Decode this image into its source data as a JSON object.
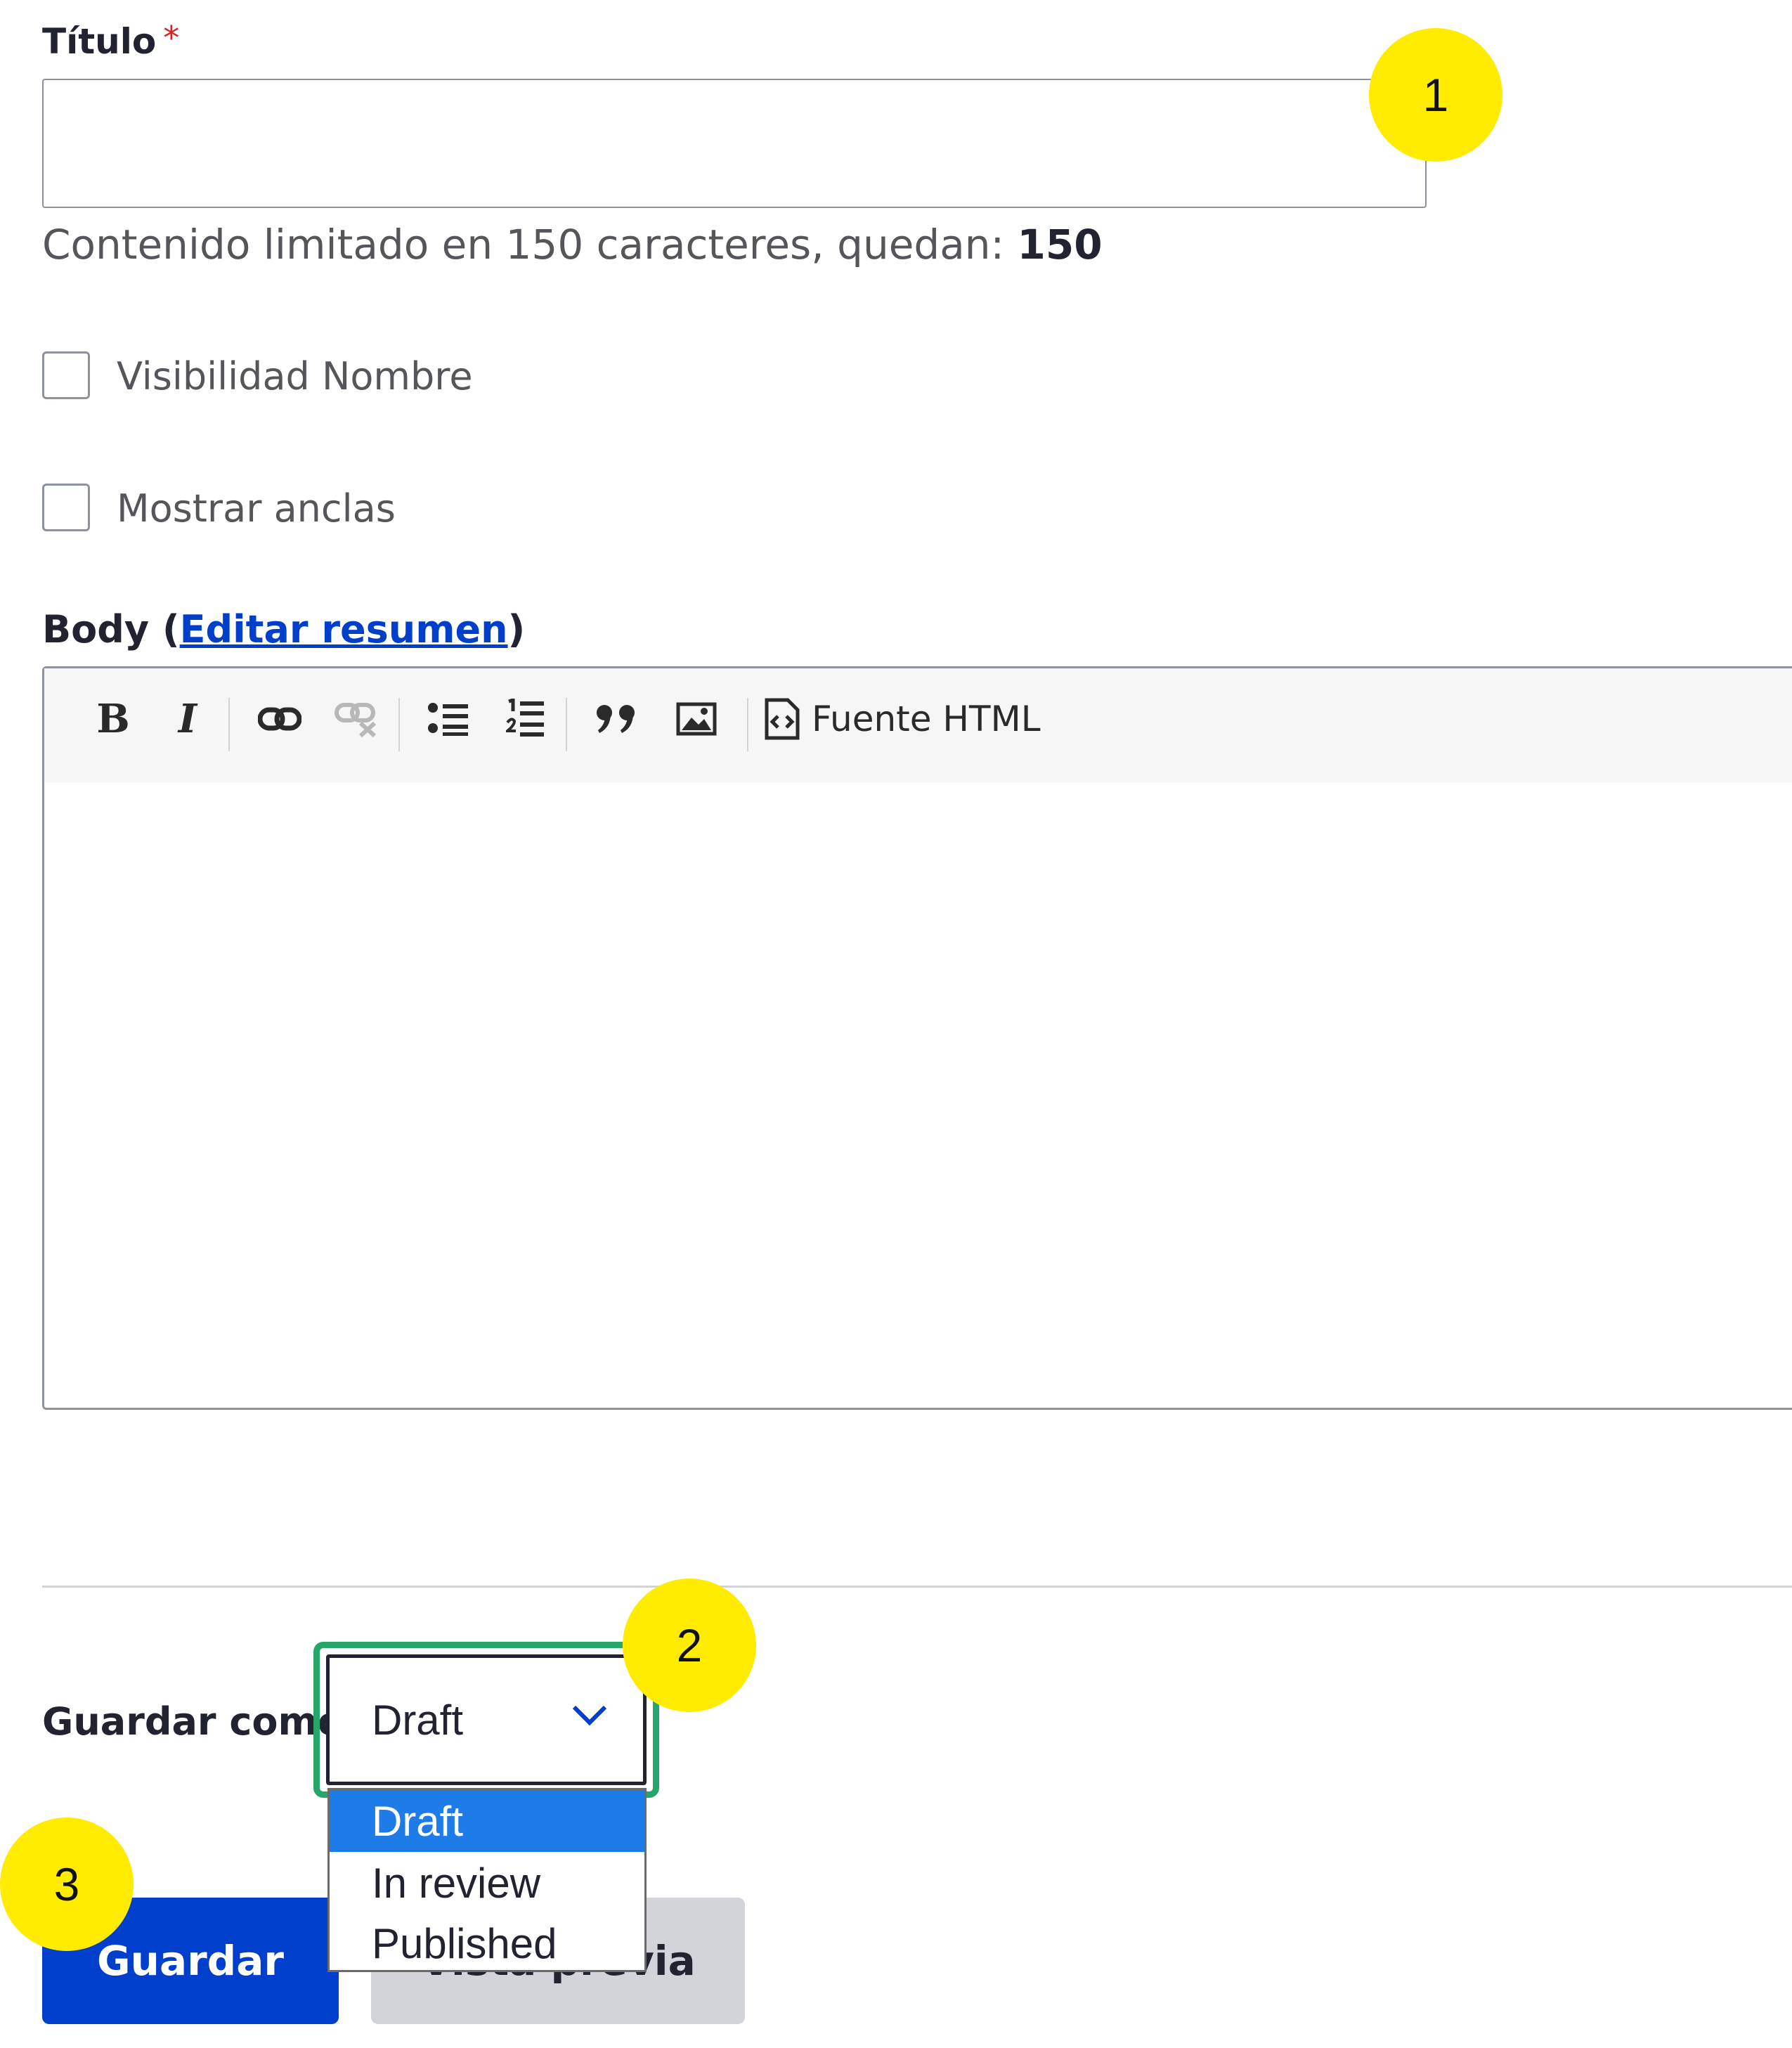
{
  "title_field": {
    "label": "Título",
    "required_mark": "*",
    "value": "",
    "counter_text": "Contenido limitado en 150 caracteres, quedan: ",
    "counter_value": "150"
  },
  "checkboxes": [
    {
      "label": "Visibilidad Nombre",
      "checked": false
    },
    {
      "label": "Mostrar anclas",
      "checked": false
    }
  ],
  "body": {
    "label": "Body",
    "open_paren": "(",
    "link": "Editar resumen",
    "close_paren": ")",
    "toolbar": {
      "icons": [
        "bold-icon",
        "italic-icon",
        "link-icon",
        "unlink-icon",
        "bulleted-list-icon",
        "numbered-list-icon",
        "blockquote-icon",
        "image-icon",
        "source-icon"
      ],
      "bold": "B",
      "italic": "I",
      "source_label": "Fuente HTML"
    },
    "value": ""
  },
  "save_as": {
    "label": "Guardar como:",
    "selected": "Draft",
    "options": [
      "Draft",
      "In review",
      "Published"
    ]
  },
  "buttons": {
    "save": "Guardar",
    "preview": "Vista previa"
  },
  "markers": [
    "1",
    "2",
    "3"
  ],
  "colors": {
    "primary": "#003ecc",
    "focus": "#26a769",
    "option_selected": "#1e7ce8",
    "marker": "#ffec00",
    "required": "#d72222"
  }
}
